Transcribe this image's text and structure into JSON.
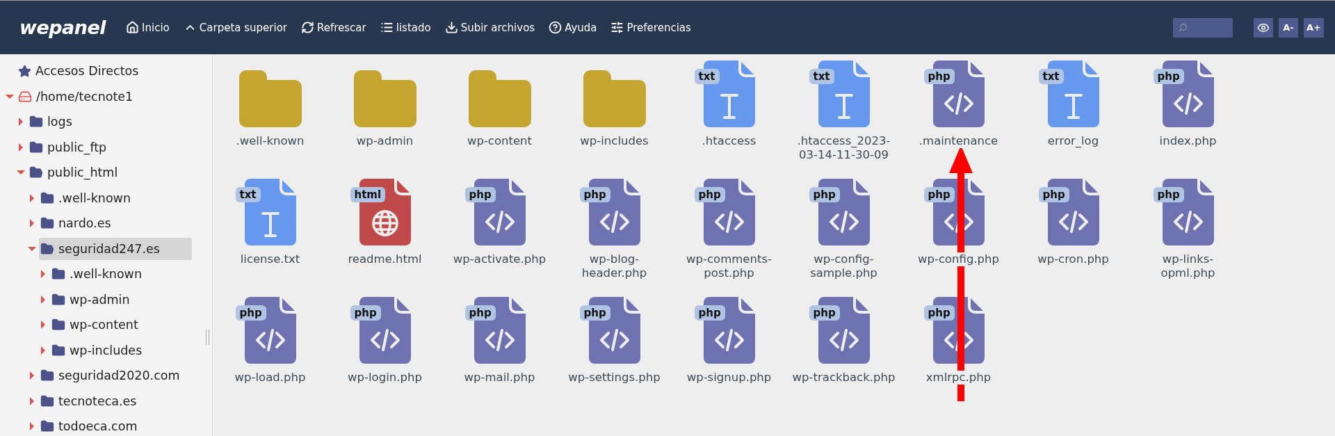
{
  "header": {
    "logo": "wepanel",
    "toolbar": [
      {
        "label": "Inicio"
      },
      {
        "label": "Carpeta superior"
      },
      {
        "label": "Refrescar"
      },
      {
        "label": "listado"
      },
      {
        "label": "Subir archivos"
      },
      {
        "label": "Ayuda"
      },
      {
        "label": "Preferencias"
      }
    ],
    "font_buttons": [
      "A-",
      "A+"
    ]
  },
  "tree": [
    {
      "kind": "shortcuts",
      "label": "Accesos Directos",
      "selected": false
    },
    {
      "kind": "drive",
      "label": "/home/tecnote1",
      "expanded": true,
      "selected": false,
      "children": [
        {
          "kind": "folder",
          "label": "logs",
          "expanded": false,
          "selected": false
        },
        {
          "kind": "folder",
          "label": "public_ftp",
          "expanded": false,
          "selected": false
        },
        {
          "kind": "folder",
          "label": "public_html",
          "expanded": true,
          "selected": false,
          "children": [
            {
              "kind": "folder",
              "label": ".well-known",
              "expanded": false,
              "selected": false
            },
            {
              "kind": "folder",
              "label": "nardo.es",
              "expanded": false,
              "selected": false
            },
            {
              "kind": "folder",
              "label": "seguridad247.es",
              "expanded": true,
              "selected": true,
              "children": [
                {
                  "kind": "folder",
                  "label": ".well-known",
                  "expanded": false,
                  "selected": false
                },
                {
                  "kind": "folder",
                  "label": "wp-admin",
                  "expanded": false,
                  "selected": false
                },
                {
                  "kind": "folder",
                  "label": "wp-content",
                  "expanded": false,
                  "selected": false
                },
                {
                  "kind": "folder",
                  "label": "wp-includes",
                  "expanded": false,
                  "selected": false
                }
              ]
            },
            {
              "kind": "folder",
              "label": "seguridad2020.com",
              "expanded": false,
              "selected": false
            },
            {
              "kind": "folder",
              "label": "tecnoteca.es",
              "expanded": false,
              "selected": false
            },
            {
              "kind": "folder",
              "label": "todoeca.com",
              "expanded": false,
              "selected": false
            }
          ]
        }
      ]
    }
  ],
  "files": [
    {
      "kind": "folder",
      "name": ".well-known"
    },
    {
      "kind": "folder",
      "name": "wp-admin"
    },
    {
      "kind": "folder",
      "name": "wp-content"
    },
    {
      "kind": "folder",
      "name": "wp-includes"
    },
    {
      "kind": "txt",
      "badge": "txt",
      "name": ".htaccess"
    },
    {
      "kind": "txt",
      "badge": "txt",
      "name": ".htaccess_2023-03-14-11-30-09"
    },
    {
      "kind": "php",
      "badge": "php",
      "name": ".maintenance"
    },
    {
      "kind": "txt",
      "badge": "txt",
      "name": "error_log"
    },
    {
      "kind": "php",
      "badge": "php",
      "name": "index.php"
    },
    {
      "kind": "txt",
      "badge": "txt",
      "name": "license.txt"
    },
    {
      "kind": "html",
      "badge": "html",
      "name": "readme.html"
    },
    {
      "kind": "php",
      "badge": "php",
      "name": "wp-activate.php"
    },
    {
      "kind": "php",
      "badge": "php",
      "name": "wp-blog-header.php"
    },
    {
      "kind": "php",
      "badge": "php",
      "name": "wp-comments-post.php"
    },
    {
      "kind": "php",
      "badge": "php",
      "name": "wp-config-sample.php"
    },
    {
      "kind": "php",
      "badge": "php",
      "name": "wp-config.php"
    },
    {
      "kind": "php",
      "badge": "php",
      "name": "wp-cron.php"
    },
    {
      "kind": "php",
      "badge": "php",
      "name": "wp-links-opml.php"
    },
    {
      "kind": "php",
      "badge": "php",
      "name": "wp-load.php"
    },
    {
      "kind": "php",
      "badge": "php",
      "name": "wp-login.php"
    },
    {
      "kind": "php",
      "badge": "php",
      "name": "wp-mail.php"
    },
    {
      "kind": "php",
      "badge": "php",
      "name": "wp-settings.php"
    },
    {
      "kind": "php",
      "badge": "php",
      "name": "wp-signup.php"
    },
    {
      "kind": "php",
      "badge": "php",
      "name": "wp-trackback.php"
    },
    {
      "kind": "php",
      "badge": "php",
      "name": "xmlrpc.php"
    }
  ],
  "annotation": {
    "kind": "arrow",
    "color": "#ff0000"
  }
}
